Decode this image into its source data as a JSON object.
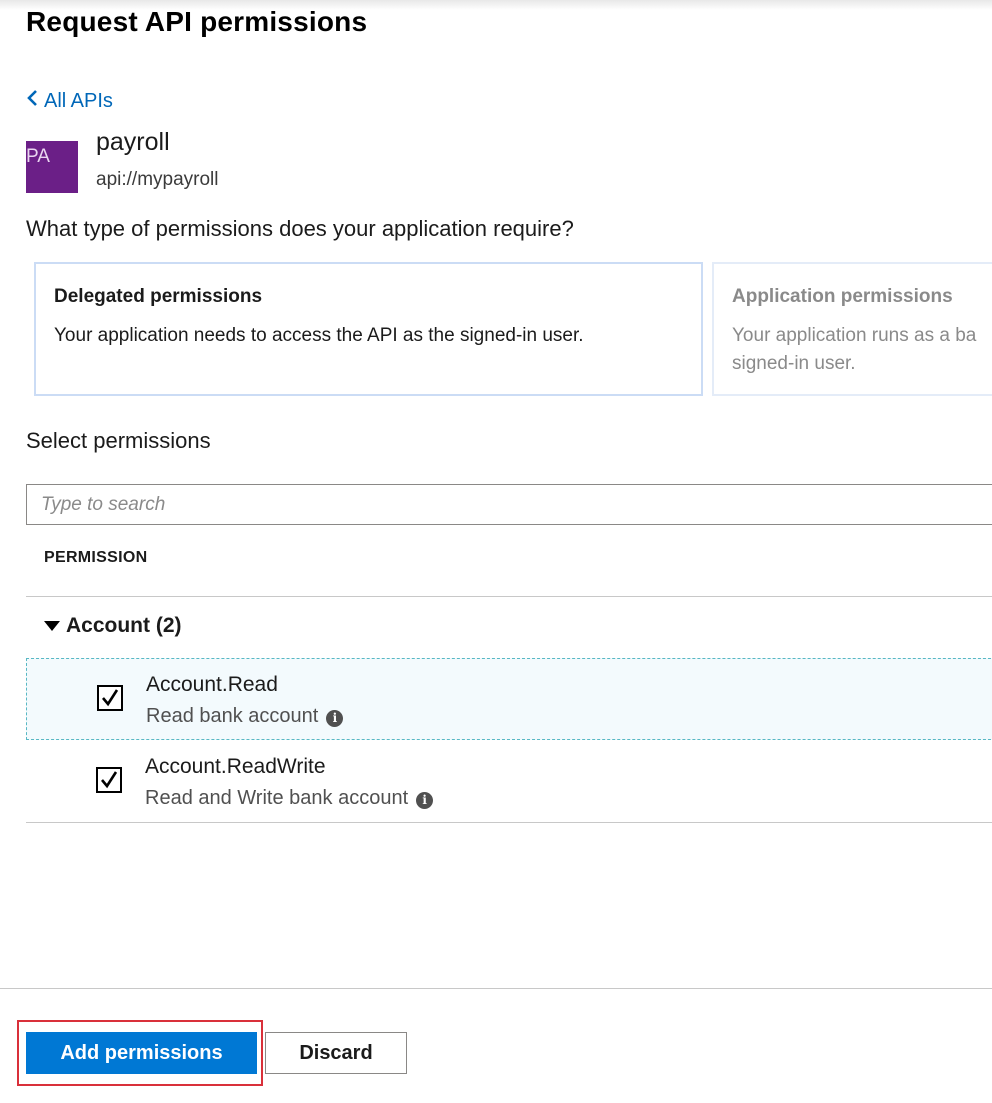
{
  "header": {
    "title": "Request API permissions"
  },
  "nav": {
    "back_label": "All APIs"
  },
  "api": {
    "logo_text": "PA",
    "logo_color": "#6b1f87",
    "name": "payroll",
    "uri": "api://mypayroll"
  },
  "permission_type": {
    "question": "What type of permissions does your application require?",
    "options": [
      {
        "title": "Delegated permissions",
        "description": "Your application needs to access the API as the signed-in user.",
        "selected": true
      },
      {
        "title": "Application permissions",
        "description_line1": "Your application runs as a ba",
        "description_line2": "signed-in user.",
        "selected": false
      }
    ]
  },
  "select_permissions": {
    "heading": "Select permissions",
    "search_placeholder": "Type to search",
    "column_header": "PERMISSION",
    "groups": [
      {
        "label": "Account (2)",
        "expanded": true,
        "items": [
          {
            "name": "Account.Read",
            "description": "Read bank account",
            "checked": true,
            "focused": true
          },
          {
            "name": "Account.ReadWrite",
            "description": "Read and Write bank account",
            "checked": true,
            "focused": false
          }
        ]
      }
    ]
  },
  "footer": {
    "primary_label": "Add permissions",
    "secondary_label": "Discard",
    "accent_color": "#0078d4",
    "highlight_color": "#d9303a"
  },
  "icons": {
    "back": "chevron-left-icon",
    "expand": "triangle-down-icon",
    "check": "checkmark-icon",
    "info": "info-icon"
  }
}
